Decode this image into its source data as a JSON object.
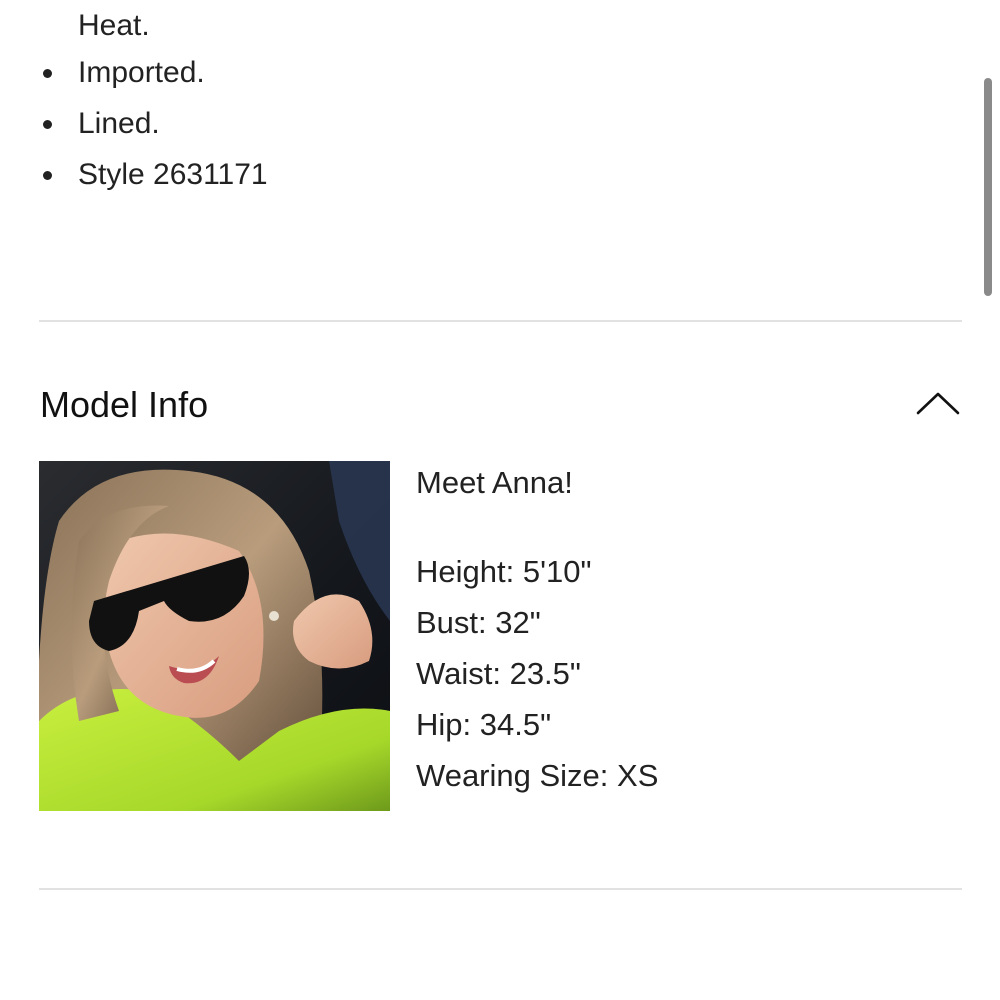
{
  "details": {
    "continued_text": "Heat.",
    "items": [
      {
        "text": "Imported."
      },
      {
        "text": "Lined."
      },
      {
        "text": "Style 2631171"
      }
    ]
  },
  "model_info": {
    "title": "Model Info",
    "toggle_icon": "chevron-up-icon",
    "expanded": true,
    "photo_alt": "Model photo",
    "intro": "Meet Anna!",
    "stats": [
      {
        "text": "Height: 5'10\""
      },
      {
        "text": "Bust: 32\""
      },
      {
        "text": "Waist: 23.5\""
      },
      {
        "text": "Hip: 34.5\""
      },
      {
        "text": "Wearing Size: XS"
      }
    ]
  },
  "colors": {
    "text": "#222222",
    "divider": "#e2e2e2",
    "scrollbar": "#8a8a8a"
  }
}
